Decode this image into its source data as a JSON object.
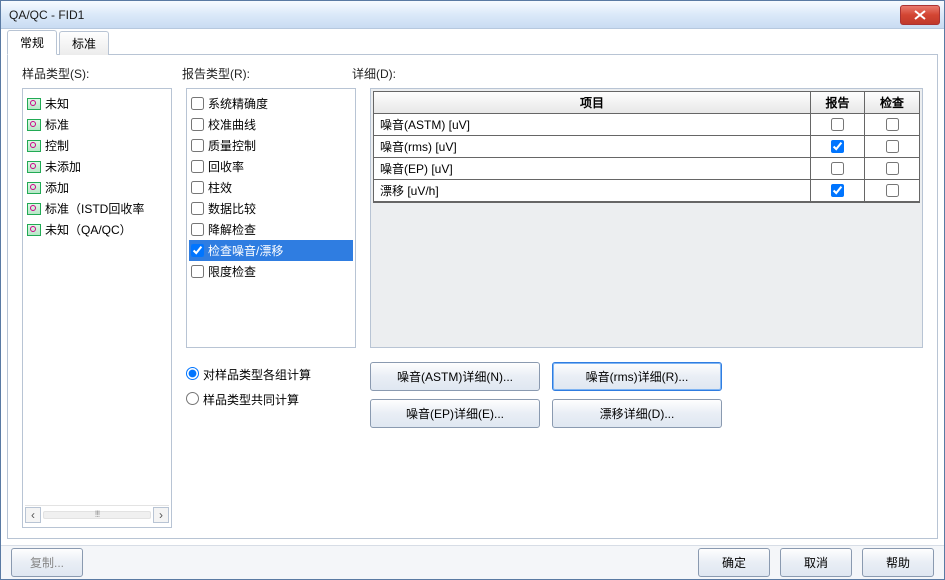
{
  "window": {
    "title": "QA/QC - FID1"
  },
  "tabs": {
    "general": "常规",
    "standard": "标准"
  },
  "labels": {
    "sample_type": "样品类型(S):",
    "report_type": "报告类型(R):",
    "detail": "详细(D):"
  },
  "sample_types": {
    "items": [
      "未知",
      "标准",
      "控制",
      "未添加",
      "添加",
      "标准（ISTD回收率",
      "未知（QA/QC）"
    ]
  },
  "report_types": {
    "items": [
      {
        "label": "系统精确度",
        "checked": false
      },
      {
        "label": "校准曲线",
        "checked": false
      },
      {
        "label": "质量控制",
        "checked": false
      },
      {
        "label": "回收率",
        "checked": false
      },
      {
        "label": "柱效",
        "checked": false
      },
      {
        "label": "数据比较",
        "checked": false
      },
      {
        "label": "降解检查",
        "checked": false
      },
      {
        "label": "检查噪音/漂移",
        "checked": true,
        "selected": true
      },
      {
        "label": "限度检查",
        "checked": false
      }
    ]
  },
  "radios": {
    "per_sample": "对样品类型各组计算",
    "shared": "样品类型共同计算",
    "value": "per_sample"
  },
  "grid": {
    "headers": {
      "item": "项目",
      "report": "报告",
      "check": "检查"
    },
    "rows": [
      {
        "item": "噪音(ASTM) [uV]",
        "report": false,
        "check": false
      },
      {
        "item": "噪音(rms) [uV]",
        "report": true,
        "check": false
      },
      {
        "item": "噪音(EP) [uV]",
        "report": false,
        "check": false
      },
      {
        "item": "漂移 [uV/h]",
        "report": true,
        "check": false
      }
    ]
  },
  "detail_buttons": {
    "astm": "噪音(ASTM)详细(N)...",
    "rms": "噪音(rms)详细(R)...",
    "ep": "噪音(EP)详细(E)...",
    "drift": "漂移详细(D)..."
  },
  "bottom": {
    "copy": "复制...",
    "ok": "确定",
    "cancel": "取消",
    "help": "帮助"
  }
}
